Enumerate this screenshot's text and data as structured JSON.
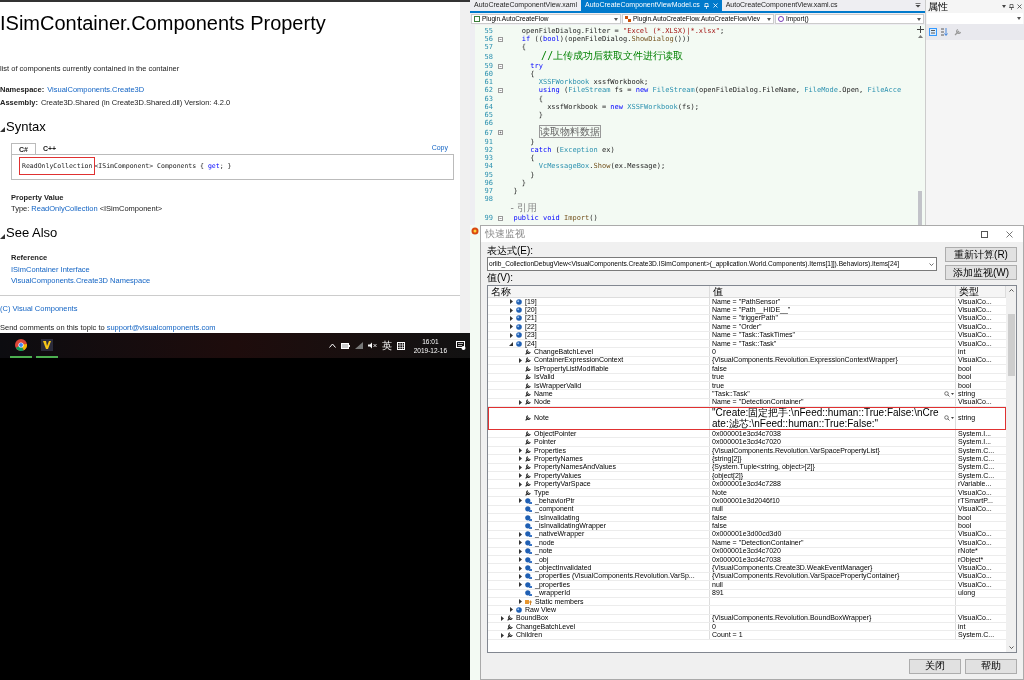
{
  "doc": {
    "title": "ISimContainer.Components Property",
    "description": "list of components currently contained in the container",
    "namespace_label": "Namespace:",
    "namespace_link": "VisualComponents.Create3D",
    "assembly_label": "Assembly:",
    "assembly_text": "Create3D.Shared (in Create3D.Shared.dll) Version: 4.2.0",
    "syntax_heading": "Syntax",
    "code_tabs": [
      {
        "label": "C#",
        "selected": true
      },
      {
        "label": "C++",
        "selected": false
      }
    ],
    "copy_link": "Copy",
    "code": [
      {
        "text": "ReadOnlyCollection",
        "highlighted": true
      },
      {
        "text": "<ISimComponent> Components { "
      },
      {
        "text": "get",
        "kind": "keyword"
      },
      {
        "text": "; }"
      }
    ],
    "property_value_heading": "Property Value",
    "type_label": "Type:",
    "type_link": "ReadOnlyCollection",
    "type_rest": "<ISimComponent>",
    "see_also_heading": "See Also",
    "reference_heading": "Reference",
    "reference_links": [
      "ISimContainer Interface",
      "VisualComponents.Create3D Namespace"
    ],
    "copyright_link": "(C) Visual Components",
    "feedback_text": "Send comments on this topic to",
    "feedback_link": "support@visualcomponents.com"
  },
  "taskbar": {
    "language": "英",
    "time": "16:01",
    "date": "2019-12-16"
  },
  "editor": {
    "tabs": [
      {
        "label": "AutoCreateComponentView.xaml",
        "selected": false
      },
      {
        "label": "AutoCreateComponentViewModel.cs",
        "selected": true
      },
      {
        "label": "AutoCreateComponentView.xaml.cs",
        "selected": false
      }
    ],
    "nav": [
      "Plugin.AutoCreateFlow",
      "Plugin.AutoCreateFlow.AutoCreateFlowViev",
      "Import()"
    ],
    "lines": [
      {
        "number": "55",
        "tokens": [
          {
            "text": "    openFileDialog.Filter = "
          },
          {
            "text": "\"Excel (*.XLSX)|*.xlsx\"",
            "kind": "string"
          },
          {
            "text": ";"
          }
        ]
      },
      {
        "number": "56",
        "collapsed": false,
        "tokens": [
          {
            "text": "    if",
            "kind": "keyword"
          },
          {
            "text": " (("
          },
          {
            "text": "bool",
            "kind": "keyword"
          },
          {
            "text": ")(openFileDialog."
          },
          {
            "text": "ShowDialog",
            "kind": "method"
          },
          {
            "text": "()))"
          }
        ]
      },
      {
        "number": "57",
        "tokens": [
          {
            "text": "    {"
          }
        ]
      },
      {
        "number": "58",
        "tokens": [
          {
            "text": "      //上传成功后获取文件进行读取",
            "kind": "comment"
          }
        ]
      },
      {
        "number": "59",
        "collapsed": false,
        "tokens": [
          {
            "text": "      try",
            "kind": "keyword"
          }
        ]
      },
      {
        "number": "60",
        "tokens": [
          {
            "text": "      {"
          }
        ]
      },
      {
        "number": "61",
        "tokens": [
          {
            "text": "        XSSFWorkbook",
            "kind": "type"
          },
          {
            "text": " xssfWorkbook;"
          }
        ]
      },
      {
        "number": "62",
        "collapsed": false,
        "tokens": [
          {
            "text": "        using",
            "kind": "keyword"
          },
          {
            "text": " ("
          },
          {
            "text": "FileStream",
            "kind": "type"
          },
          {
            "text": " fs = "
          },
          {
            "text": "new",
            "kind": "keyword"
          },
          {
            "text": " FileStream",
            "kind": "type"
          },
          {
            "text": "(openFileDialog.FileName, "
          },
          {
            "text": "FileMode",
            "kind": "type"
          },
          {
            "text": ".Open, "
          },
          {
            "text": "FileAcce",
            "kind": "type"
          }
        ]
      },
      {
        "number": "63",
        "tokens": [
          {
            "text": "        {"
          }
        ]
      },
      {
        "number": "64",
        "tokens": [
          {
            "text": "          xssfWorkbook = "
          },
          {
            "text": "new",
            "kind": "keyword"
          },
          {
            "text": " XSSFWorkbook",
            "kind": "type"
          },
          {
            "text": "(fs);"
          }
        ]
      },
      {
        "number": "65",
        "tokens": [
          {
            "text": "        }"
          }
        ]
      },
      {
        "number": "66"
      },
      {
        "number": "67",
        "collapsed": true,
        "tokens": [
          {
            "text": "读取物料数据",
            "kind": "collapsed"
          }
        ]
      },
      {
        "number": "91",
        "tokens": [
          {
            "text": "      }"
          }
        ]
      },
      {
        "number": "92",
        "tokens": [
          {
            "text": "      catch",
            "kind": "keyword"
          },
          {
            "text": " ("
          },
          {
            "text": "Exception",
            "kind": "type"
          },
          {
            "text": " ex)"
          }
        ]
      },
      {
        "number": "93",
        "tokens": [
          {
            "text": "      {"
          }
        ]
      },
      {
        "number": "94",
        "tokens": [
          {
            "text": "        VcMessageBox",
            "kind": "type"
          },
          {
            "text": "."
          },
          {
            "text": "Show",
            "kind": "method"
          },
          {
            "text": "(ex.Message);"
          }
        ]
      },
      {
        "number": "95",
        "tokens": [
          {
            "text": "      }"
          }
        ]
      },
      {
        "number": "96",
        "tokens": [
          {
            "text": "    }"
          }
        ]
      },
      {
        "number": "97",
        "tokens": [
          {
            "text": "  }"
          }
        ]
      },
      {
        "number": "98"
      },
      {
        "tokens": [
          {
            "text": "  - 引用",
            "kind": "lens"
          }
        ]
      },
      {
        "number": "99",
        "collapsed": false,
        "tokens": [
          {
            "text": "  public",
            "kind": "keyword"
          },
          {
            "text": " void",
            "kind": "keyword"
          },
          {
            "text": " Import",
            "kind": "method"
          },
          {
            "text": "()"
          }
        ]
      }
    ]
  },
  "properties_panel": {
    "title": "属性"
  },
  "quick_watch": {
    "title": "快速监视",
    "expression_label": "表达式(E):",
    "expression": "orlib_CollectionDebugView<VisualComponents.Create3D.ISimComponent>(_application.World.Components).Items[1]]).Behaviors).Items[24]",
    "recalc_button": "重新计算(R)",
    "add_watch_button": "添加监视(W)",
    "value_label": "值(V):",
    "columns": [
      "名称",
      "值",
      "类型"
    ],
    "items": [
      {
        "children": [
          {
            "name": "[19]",
            "value": "Name = \"PathSensor\"",
            "type": "VisualCo...",
            "kind": "object",
            "expanded": false
          },
          {
            "name": "[20]",
            "value": "Name = \"Path__HIDE__\"",
            "type": "VisualCo...",
            "kind": "object",
            "expanded": false
          },
          {
            "name": "[21]",
            "value": "Name = \"triggerPath\"",
            "type": "VisualCo...",
            "kind": "object",
            "expanded": false
          },
          {
            "name": "[22]",
            "value": "Name = \"Order\"",
            "type": "VisualCo...",
            "kind": "object",
            "expanded": false
          },
          {
            "name": "[23]",
            "value": "Name = \"Task::TaskTimes\"",
            "type": "VisualCo...",
            "kind": "object",
            "expanded": false
          },
          {
            "name": "[24]",
            "value": "Name = \"Task::Task\"",
            "type": "VisualCo...",
            "kind": "object",
            "expanded": true,
            "children": [
              {
                "name": "ChangeBatchLevel",
                "value": "0",
                "type": "int",
                "kind": "property"
              },
              {
                "name": "ContainerExpressionContext",
                "value": "{VisualComponents.Revolution.ExpressionContextWrapper}",
                "type": "VisualCo...",
                "kind": "property",
                "expanded": false
              },
              {
                "name": "IsPropertyListModifiable",
                "value": "false",
                "type": "bool",
                "kind": "property"
              },
              {
                "name": "IsValid",
                "value": "true",
                "type": "bool",
                "kind": "property"
              },
              {
                "name": "IsWrapperValid",
                "value": "true",
                "type": "bool",
                "kind": "property"
              },
              {
                "name": "Name",
                "value": "\"Task::Task\"",
                "type": "string",
                "kind": "property",
                "visualizer": true
              },
              {
                "name": "Node",
                "value": "Name = \"DetectionContainer\"",
                "type": "VisualCo...",
                "kind": "property",
                "expanded": false
              },
              {
                "name": "Note",
                "value": "\"Create:固定把手:\\nFeed::human::True:False:\\nCreate:滤芯:\\nFeed::human::True:False:\"",
                "type": "string",
                "kind": "property",
                "visualizer": true,
                "highlighted": true
              },
              {
                "name": "ObjectPointer",
                "value": "0x000001e3cd4c7038",
                "type": "System.I...",
                "kind": "property"
              },
              {
                "name": "Pointer",
                "value": "0x000001e3cd4c7020",
                "type": "System.I...",
                "kind": "property"
              },
              {
                "name": "Properties",
                "value": "{VisualComponents.Revolution.VarSpacePropertyList}",
                "type": "System.C...",
                "kind": "property",
                "expanded": false
              },
              {
                "name": "PropertyNames",
                "value": "{string[2]}",
                "type": "System.C...",
                "kind": "property",
                "expanded": false
              },
              {
                "name": "PropertyNamesAndValues",
                "value": "{System.Tuple<string, object>[2]}",
                "type": "System.C...",
                "kind": "property",
                "expanded": false
              },
              {
                "name": "PropertyValues",
                "value": "{object[2]}",
                "type": "System.C...",
                "kind": "property",
                "expanded": false
              },
              {
                "name": "PropertyVarSpace",
                "value": "0x000001e3cd4c7288",
                "type": "rVariable...",
                "kind": "property",
                "expanded": false
              },
              {
                "name": "Type",
                "value": "Note",
                "type": "VisualCo...",
                "kind": "property"
              },
              {
                "name": "_behaviorPtr",
                "value": "0x000001e3d2046f10",
                "type": "rTSmartP...",
                "kind": "field",
                "expanded": false
              },
              {
                "name": "_component",
                "value": "null",
                "type": "VisualCo...",
                "kind": "field"
              },
              {
                "name": "_isInvalidating",
                "value": "false",
                "type": "bool",
                "kind": "field"
              },
              {
                "name": "_isInvalidatingWrapper",
                "value": "false",
                "type": "bool",
                "kind": "field"
              },
              {
                "name": "_nativeWrapper",
                "value": "0x000001e3d00cd3d0",
                "type": "VisualCo...",
                "kind": "field",
                "expanded": false
              },
              {
                "name": "_node",
                "value": "Name = \"DetectionContainer\"",
                "type": "VisualCo...",
                "kind": "field",
                "expanded": false
              },
              {
                "name": "_note",
                "value": "0x000001e3cd4c7020",
                "type": "rNote*",
                "kind": "field",
                "expanded": false
              },
              {
                "name": "_obj",
                "value": "0x000001e3cd4c7038",
                "type": "rObject*",
                "kind": "field",
                "expanded": false
              },
              {
                "name": "_objectInvalidated",
                "value": "{VisualComponents.Create3D.WeakEventManager}",
                "type": "VisualCo...",
                "kind": "field",
                "expanded": false
              },
              {
                "name": "_properties (VisualComponents.Revolution.VarSp...",
                "value": "{VisualComponents.Revolution.VarSpacePropertyContainer}",
                "type": "VisualCo...",
                "kind": "field",
                "expanded": false
              },
              {
                "name": "_properties",
                "value": "null",
                "type": "VisualCo...",
                "kind": "field",
                "expanded": false
              },
              {
                "name": "_wrapperId",
                "value": "891",
                "type": "ulong",
                "kind": "field"
              },
              {
                "name": "Static members",
                "kind": "static",
                "expanded": false
              }
            ]
          },
          {
            "name": "Raw View",
            "kind": "object",
            "expanded": false
          }
        ]
      },
      {
        "name": "BoundBox",
        "value": "{VisualComponents.Revolution.BoundBoxWrapper}",
        "type": "VisualCo...",
        "kind": "property",
        "expanded": false
      },
      {
        "name": "ChangeBatchLevel",
        "value": "0",
        "type": "int",
        "kind": "property"
      },
      {
        "name": "Children",
        "value": "Count = 1",
        "type": "System.C...",
        "kind": "property",
        "expanded": false
      }
    ],
    "buttons": [
      "关闭",
      "帮助"
    ]
  }
}
